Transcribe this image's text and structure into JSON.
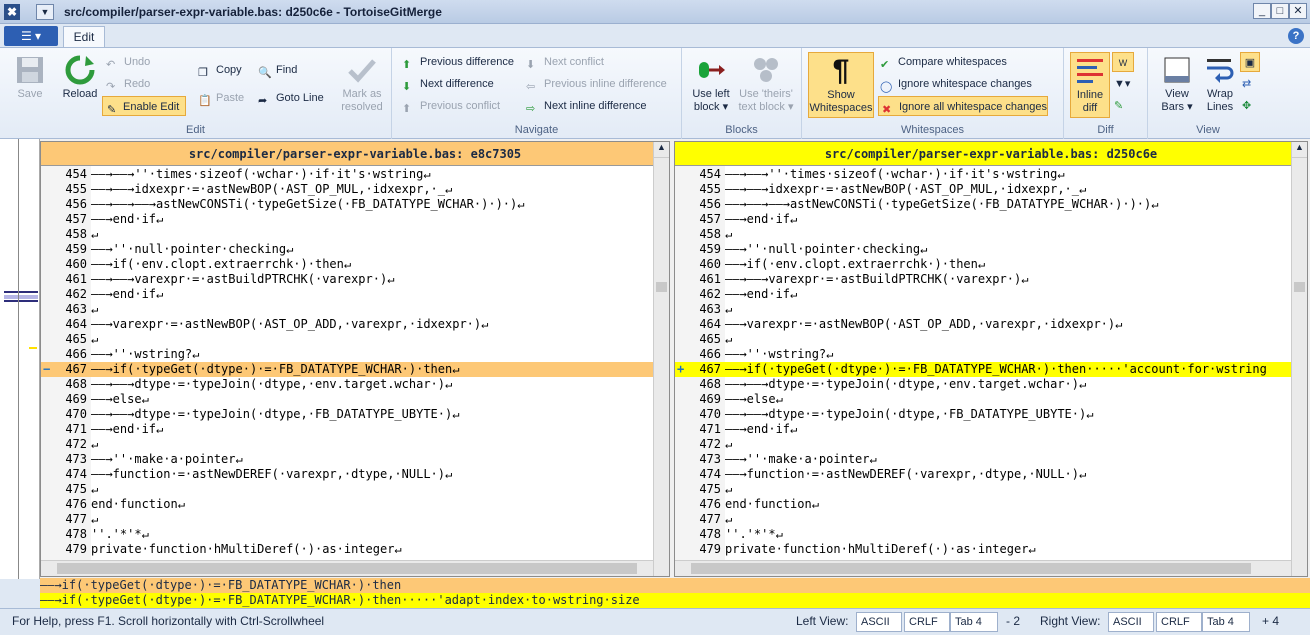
{
  "window": {
    "title": "src/compiler/parser-expr-variable.bas: d250c6e - TortoiseGitMerge"
  },
  "tabs": {
    "edit": "Edit"
  },
  "ribbon": {
    "edit": {
      "save": "Save",
      "reload": "Reload",
      "undo": "Undo",
      "redo": "Redo",
      "enable_edit": "Enable Edit",
      "copy": "Copy",
      "paste": "Paste",
      "find": "Find",
      "goto_line": "Goto Line",
      "group": "Edit"
    },
    "navigate": {
      "mark_as_resolved_1": "Mark as",
      "mark_as_resolved_2": "resolved",
      "previous_difference": "Previous difference",
      "next_difference": "Next difference",
      "previous_conflict": "Previous conflict",
      "next_conflict": "Next conflict",
      "previous_inline": "Previous inline difference",
      "next_inline": "Next inline difference",
      "group": "Navigate"
    },
    "blocks": {
      "use_left_1": "Use left",
      "use_left_2": "block",
      "use_theirs_1": "Use 'theirs'",
      "use_theirs_2": "text block",
      "group": "Blocks"
    },
    "whitespaces": {
      "show_1": "Show",
      "show_2": "Whitespaces",
      "compare": "Compare whitespaces",
      "ignore_changes": "Ignore whitespace changes",
      "ignore_all": "Ignore all whitespace changes",
      "group": "Whitespaces"
    },
    "diff": {
      "inline_1": "Inline",
      "inline_2": "diff",
      "group": "Diff"
    },
    "view": {
      "view_bars_1": "View",
      "view_bars_2": "Bars",
      "wrap_1": "Wrap",
      "wrap_2": "Lines",
      "group": "View"
    }
  },
  "left_pane": {
    "header": "src/compiler/parser-expr-variable.bas: e8c7305"
  },
  "right_pane": {
    "header": "src/compiler/parser-expr-variable.bas: d250c6e"
  },
  "left_lines": [
    {
      "n": "454",
      "t": "——→——→''·times·sizeof(·wchar·)·if·it's·wstring↵"
    },
    {
      "n": "455",
      "t": "——→——→idxexpr·=·astNewBOP(·AST_OP_MUL,·idxexpr,·_↵"
    },
    {
      "n": "456",
      "t": "——→——→——→astNewCONSTi(·typeGetSize(·FB_DATATYPE_WCHAR·)·)·)↵"
    },
    {
      "n": "457",
      "t": "——→end·if↵"
    },
    {
      "n": "458",
      "t": "↵"
    },
    {
      "n": "459",
      "t": "——→''·null·pointer·checking↵"
    },
    {
      "n": "460",
      "t": "——→if(·env.clopt.extraerrchk·)·then↵"
    },
    {
      "n": "461",
      "t": "——→——→varexpr·=·astBuildPTRCHK(·varexpr·)↵"
    },
    {
      "n": "462",
      "t": "——→end·if↵"
    },
    {
      "n": "463",
      "t": "↵"
    },
    {
      "n": "464",
      "t": "——→varexpr·=·astNewBOP(·AST_OP_ADD,·varexpr,·idxexpr·)↵"
    },
    {
      "n": "465",
      "t": "↵"
    },
    {
      "n": "466",
      "t": "——→''·wstring?↵"
    },
    {
      "n": "467",
      "t": "——→if(·typeGet(·dtype·)·=·FB_DATATYPE_WCHAR·)·then↵",
      "mark": "−",
      "hl": true
    },
    {
      "n": "468",
      "t": "——→——→dtype·=·typeJoin(·dtype,·env.target.wchar·)↵"
    },
    {
      "n": "469",
      "t": "——→else↵"
    },
    {
      "n": "470",
      "t": "——→——→dtype·=·typeJoin(·dtype,·FB_DATATYPE_UBYTE·)↵"
    },
    {
      "n": "471",
      "t": "——→end·if↵"
    },
    {
      "n": "472",
      "t": "↵"
    },
    {
      "n": "473",
      "t": "——→''·make·a·pointer↵"
    },
    {
      "n": "474",
      "t": "——→function·=·astNewDEREF(·varexpr,·dtype,·NULL·)↵"
    },
    {
      "n": "475",
      "t": "↵"
    },
    {
      "n": "476",
      "t": "end·function↵"
    },
    {
      "n": "477",
      "t": "↵"
    },
    {
      "n": "478",
      "t": "''.'*'*↵"
    },
    {
      "n": "479",
      "t": "private·function·hMultiDeref(·)·as·integer↵"
    }
  ],
  "right_lines": [
    {
      "n": "454",
      "t": "——→——→''·times·sizeof(·wchar·)·if·it's·wstring↵"
    },
    {
      "n": "455",
      "t": "——→——→idxexpr·=·astNewBOP(·AST_OP_MUL,·idxexpr,·_↵"
    },
    {
      "n": "456",
      "t": "——→——→——→astNewCONSTi(·typeGetSize(·FB_DATATYPE_WCHAR·)·)·)↵"
    },
    {
      "n": "457",
      "t": "——→end·if↵"
    },
    {
      "n": "458",
      "t": "↵"
    },
    {
      "n": "459",
      "t": "——→''·null·pointer·checking↵"
    },
    {
      "n": "460",
      "t": "——→if(·env.clopt.extraerrchk·)·then↵"
    },
    {
      "n": "461",
      "t": "——→——→varexpr·=·astBuildPTRCHK(·varexpr·)↵"
    },
    {
      "n": "462",
      "t": "——→end·if↵"
    },
    {
      "n": "463",
      "t": "↵"
    },
    {
      "n": "464",
      "t": "——→varexpr·=·astNewBOP(·AST_OP_ADD,·varexpr,·idxexpr·)↵"
    },
    {
      "n": "465",
      "t": "↵"
    },
    {
      "n": "466",
      "t": "——→''·wstring?↵"
    },
    {
      "n": "467",
      "t": "——→if(·typeGet(·dtype·)·=·FB_DATATYPE_WCHAR·)·then·····'account·for·wstring",
      "mark": "+",
      "hl": true
    },
    {
      "n": "468",
      "t": "——→——→dtype·=·typeJoin(·dtype,·env.target.wchar·)↵"
    },
    {
      "n": "469",
      "t": "——→else↵"
    },
    {
      "n": "470",
      "t": "——→——→dtype·=·typeJoin(·dtype,·FB_DATATYPE_UBYTE·)↵"
    },
    {
      "n": "471",
      "t": "——→end·if↵"
    },
    {
      "n": "472",
      "t": "↵"
    },
    {
      "n": "473",
      "t": "——→''·make·a·pointer↵"
    },
    {
      "n": "474",
      "t": "——→function·=·astNewDEREF(·varexpr,·dtype,·NULL·)↵"
    },
    {
      "n": "475",
      "t": "↵"
    },
    {
      "n": "476",
      "t": "end·function↵"
    },
    {
      "n": "477",
      "t": "↵"
    },
    {
      "n": "478",
      "t": "''.'*'*↵"
    },
    {
      "n": "479",
      "t": "private·function·hMultiDeref(·)·as·integer↵"
    }
  ],
  "bottom_view": {
    "left": "——→if(·typeGet(·dtype·)·=·FB_DATATYPE_WCHAR·)·then",
    "right": "——→if(·typeGet(·dtype·)·=·FB_DATATYPE_WCHAR·)·then·····'adapt·index·to·wstring·size"
  },
  "status": {
    "help": "For Help, press F1. Scroll horizontally with Ctrl-Scrollwheel",
    "left_view": "Left View:",
    "right_view": "Right View:",
    "encoding": "ASCII",
    "eol": "CRLF",
    "tab": "Tab 4",
    "left_delta": "- 2",
    "right_delta": "+ 4"
  },
  "colors": {
    "left_changed": "#fdc876",
    "right_changed": "#ffff00",
    "accent": "#2d5fb3"
  }
}
